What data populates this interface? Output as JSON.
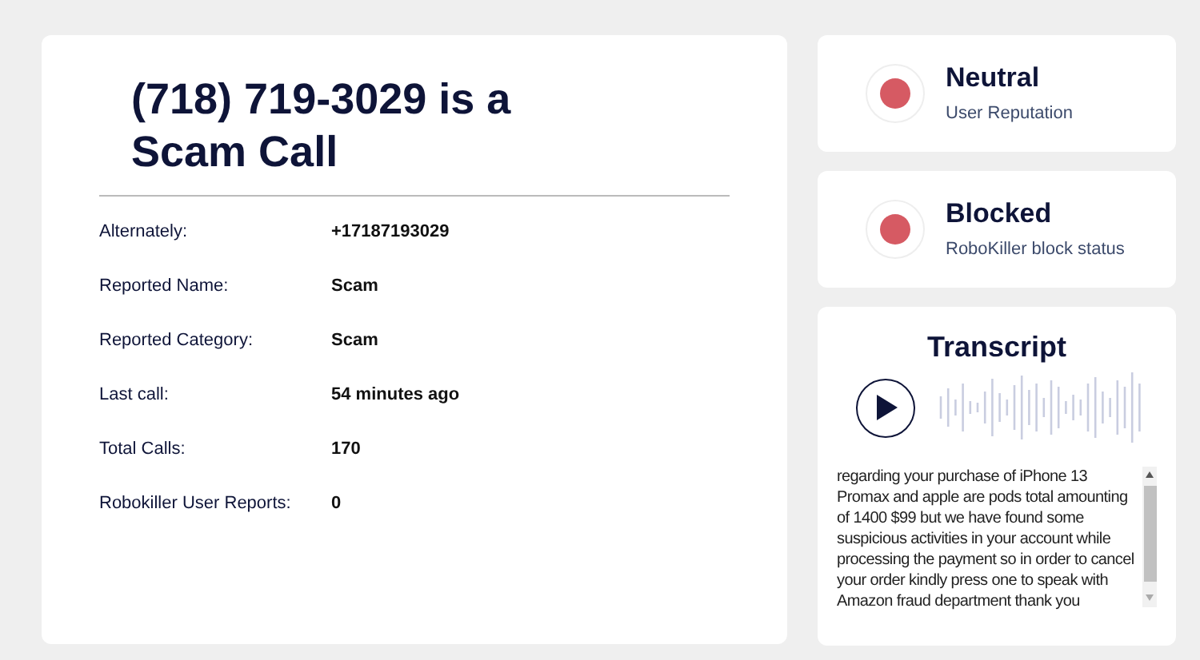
{
  "title": "(718) 719-3029 is a Scam Call",
  "details": [
    {
      "label": "Alternately:",
      "value": "+17187193029"
    },
    {
      "label": "Reported Name:",
      "value": "Scam"
    },
    {
      "label": "Reported Category:",
      "value": "Scam"
    },
    {
      "label": "Last call:",
      "value": "54 minutes ago"
    },
    {
      "label": "Total Calls:",
      "value": "170"
    },
    {
      "label": "Robokiller User Reports:",
      "value": "0"
    }
  ],
  "status_cards": [
    {
      "heading": "Neutral",
      "caption": "User Reputation",
      "color": "#d65a63"
    },
    {
      "heading": "Blocked",
      "caption": "RoboKiller block status",
      "color": "#d65a63"
    }
  ],
  "transcript": {
    "heading": "Transcript",
    "text": "regarding your purchase of iPhone 13 Promax and apple are pods total amounting of 1400 $99 but we have found some suspicious activities in your account while processing the payment so in order to cancel your order kindly press one to speak with Amazon fraud department thank you"
  }
}
